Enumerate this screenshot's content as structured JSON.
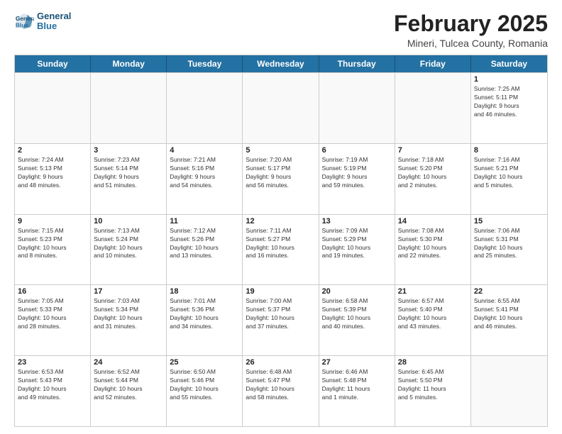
{
  "header": {
    "logo_line1": "General",
    "logo_line2": "Blue",
    "title": "February 2025",
    "subtitle": "Mineri, Tulcea County, Romania"
  },
  "weekdays": [
    "Sunday",
    "Monday",
    "Tuesday",
    "Wednesday",
    "Thursday",
    "Friday",
    "Saturday"
  ],
  "rows": [
    [
      {
        "day": "",
        "info": "",
        "empty": true
      },
      {
        "day": "",
        "info": "",
        "empty": true
      },
      {
        "day": "",
        "info": "",
        "empty": true
      },
      {
        "day": "",
        "info": "",
        "empty": true
      },
      {
        "day": "",
        "info": "",
        "empty": true
      },
      {
        "day": "",
        "info": "",
        "empty": true
      },
      {
        "day": "1",
        "info": "Sunrise: 7:25 AM\nSunset: 5:11 PM\nDaylight: 9 hours\nand 46 minutes.",
        "empty": false
      }
    ],
    [
      {
        "day": "2",
        "info": "Sunrise: 7:24 AM\nSunset: 5:13 PM\nDaylight: 9 hours\nand 48 minutes.",
        "empty": false
      },
      {
        "day": "3",
        "info": "Sunrise: 7:23 AM\nSunset: 5:14 PM\nDaylight: 9 hours\nand 51 minutes.",
        "empty": false
      },
      {
        "day": "4",
        "info": "Sunrise: 7:21 AM\nSunset: 5:16 PM\nDaylight: 9 hours\nand 54 minutes.",
        "empty": false
      },
      {
        "day": "5",
        "info": "Sunrise: 7:20 AM\nSunset: 5:17 PM\nDaylight: 9 hours\nand 56 minutes.",
        "empty": false
      },
      {
        "day": "6",
        "info": "Sunrise: 7:19 AM\nSunset: 5:19 PM\nDaylight: 9 hours\nand 59 minutes.",
        "empty": false
      },
      {
        "day": "7",
        "info": "Sunrise: 7:18 AM\nSunset: 5:20 PM\nDaylight: 10 hours\nand 2 minutes.",
        "empty": false
      },
      {
        "day": "8",
        "info": "Sunrise: 7:16 AM\nSunset: 5:21 PM\nDaylight: 10 hours\nand 5 minutes.",
        "empty": false
      }
    ],
    [
      {
        "day": "9",
        "info": "Sunrise: 7:15 AM\nSunset: 5:23 PM\nDaylight: 10 hours\nand 8 minutes.",
        "empty": false
      },
      {
        "day": "10",
        "info": "Sunrise: 7:13 AM\nSunset: 5:24 PM\nDaylight: 10 hours\nand 10 minutes.",
        "empty": false
      },
      {
        "day": "11",
        "info": "Sunrise: 7:12 AM\nSunset: 5:26 PM\nDaylight: 10 hours\nand 13 minutes.",
        "empty": false
      },
      {
        "day": "12",
        "info": "Sunrise: 7:11 AM\nSunset: 5:27 PM\nDaylight: 10 hours\nand 16 minutes.",
        "empty": false
      },
      {
        "day": "13",
        "info": "Sunrise: 7:09 AM\nSunset: 5:29 PM\nDaylight: 10 hours\nand 19 minutes.",
        "empty": false
      },
      {
        "day": "14",
        "info": "Sunrise: 7:08 AM\nSunset: 5:30 PM\nDaylight: 10 hours\nand 22 minutes.",
        "empty": false
      },
      {
        "day": "15",
        "info": "Sunrise: 7:06 AM\nSunset: 5:31 PM\nDaylight: 10 hours\nand 25 minutes.",
        "empty": false
      }
    ],
    [
      {
        "day": "16",
        "info": "Sunrise: 7:05 AM\nSunset: 5:33 PM\nDaylight: 10 hours\nand 28 minutes.",
        "empty": false
      },
      {
        "day": "17",
        "info": "Sunrise: 7:03 AM\nSunset: 5:34 PM\nDaylight: 10 hours\nand 31 minutes.",
        "empty": false
      },
      {
        "day": "18",
        "info": "Sunrise: 7:01 AM\nSunset: 5:36 PM\nDaylight: 10 hours\nand 34 minutes.",
        "empty": false
      },
      {
        "day": "19",
        "info": "Sunrise: 7:00 AM\nSunset: 5:37 PM\nDaylight: 10 hours\nand 37 minutes.",
        "empty": false
      },
      {
        "day": "20",
        "info": "Sunrise: 6:58 AM\nSunset: 5:39 PM\nDaylight: 10 hours\nand 40 minutes.",
        "empty": false
      },
      {
        "day": "21",
        "info": "Sunrise: 6:57 AM\nSunset: 5:40 PM\nDaylight: 10 hours\nand 43 minutes.",
        "empty": false
      },
      {
        "day": "22",
        "info": "Sunrise: 6:55 AM\nSunset: 5:41 PM\nDaylight: 10 hours\nand 46 minutes.",
        "empty": false
      }
    ],
    [
      {
        "day": "23",
        "info": "Sunrise: 6:53 AM\nSunset: 5:43 PM\nDaylight: 10 hours\nand 49 minutes.",
        "empty": false
      },
      {
        "day": "24",
        "info": "Sunrise: 6:52 AM\nSunset: 5:44 PM\nDaylight: 10 hours\nand 52 minutes.",
        "empty": false
      },
      {
        "day": "25",
        "info": "Sunrise: 6:50 AM\nSunset: 5:46 PM\nDaylight: 10 hours\nand 55 minutes.",
        "empty": false
      },
      {
        "day": "26",
        "info": "Sunrise: 6:48 AM\nSunset: 5:47 PM\nDaylight: 10 hours\nand 58 minutes.",
        "empty": false
      },
      {
        "day": "27",
        "info": "Sunrise: 6:46 AM\nSunset: 5:48 PM\nDaylight: 11 hours\nand 1 minute.",
        "empty": false
      },
      {
        "day": "28",
        "info": "Sunrise: 6:45 AM\nSunset: 5:50 PM\nDaylight: 11 hours\nand 5 minutes.",
        "empty": false
      },
      {
        "day": "",
        "info": "",
        "empty": true
      }
    ]
  ]
}
